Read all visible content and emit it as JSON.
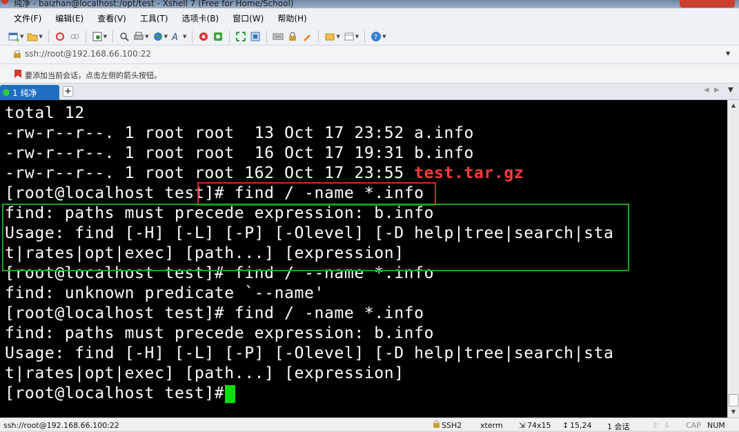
{
  "window": {
    "title": "纯净 - baizhan@localhost:/opt/test - Xshell 7 (Free for Home/School)"
  },
  "menu": [
    "文件(F)",
    "编辑(E)",
    "查看(V)",
    "工具(T)",
    "选项卡(B)",
    "窗口(W)",
    "帮助(H)"
  ],
  "address": {
    "value": "ssh://root@192.168.66.100:22"
  },
  "hint": {
    "text": "要添加当前会话，点击左侧的箭头按钮。"
  },
  "tab": {
    "label": "1 纯净",
    "add_label": "+"
  },
  "terminal": {
    "lines": [
      "total 12",
      "-rw-r--r--. 1 root root  13 Oct 17 23:52 a.info",
      "-rw-r--r--. 1 root root  16 Oct 17 19:31 b.info",
      "-rw-r--r--. 1 root root 162 Oct 17 23:55 ",
      "[root@localhost test]# find / -name *.info",
      "find: paths must precede expression: b.info",
      "Usage: find [-H] [-L] [-P] [-Olevel] [-D help|tree|search|sta",
      "t|rates|opt|exec] [path...] [expression]",
      "[root@localhost test]# find / --name *.info",
      "find: unknown predicate `--name'",
      "[root@localhost test]# find / -name *.info",
      "find: paths must precede expression: b.info",
      "Usage: find [-H] [-L] [-P] [-Olevel] [-D help|tree|search|sta",
      "t|rates|opt|exec] [path...] [expression]",
      "[root@localhost test]# "
    ],
    "archive_name": "test.tar.gz",
    "archive_color": "#ff3b3b",
    "cursor_color": "#00e000"
  },
  "status": {
    "connection": "ssh://root@192.168.66.100:22",
    "protocol": "SSH2",
    "term": "xterm",
    "size": "74x15",
    "pos": "15,24",
    "sessions": "1 会话",
    "cap": "CAP",
    "num": "NUM"
  }
}
